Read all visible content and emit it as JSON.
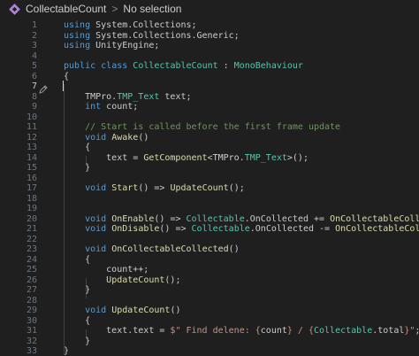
{
  "breadcrumb": {
    "file": "CollectableCount",
    "separator": ">",
    "selection": "No selection",
    "icon": "csharp-class-icon"
  },
  "editor": {
    "active_line": 7,
    "lines": [
      {
        "n": "1",
        "tokens": [
          [
            "k",
            "using"
          ],
          [
            "p",
            " System.Collections;"
          ]
        ]
      },
      {
        "n": "2",
        "tokens": [
          [
            "k",
            "using"
          ],
          [
            "p",
            " System.Collections.Generic;"
          ]
        ]
      },
      {
        "n": "3",
        "tokens": [
          [
            "k",
            "using"
          ],
          [
            "p",
            " UnityEngine;"
          ]
        ]
      },
      {
        "n": "4",
        "tokens": []
      },
      {
        "n": "5",
        "tokens": [
          [
            "k",
            "public"
          ],
          [
            "p",
            " "
          ],
          [
            "k",
            "class"
          ],
          [
            "p",
            " "
          ],
          [
            "t",
            "CollectableCount"
          ],
          [
            "p",
            " : "
          ],
          [
            "t",
            "MonoBehaviour"
          ]
        ]
      },
      {
        "n": "6",
        "tokens": [
          [
            "p",
            "{"
          ]
        ]
      },
      {
        "n": "7",
        "tokens": []
      },
      {
        "n": "8",
        "tokens": [
          [
            "p",
            "    TMPro."
          ],
          [
            "t",
            "TMP_Text"
          ],
          [
            "p",
            " text;"
          ]
        ]
      },
      {
        "n": "9",
        "tokens": [
          [
            "p",
            "    "
          ],
          [
            "k",
            "int"
          ],
          [
            "p",
            " count;"
          ]
        ]
      },
      {
        "n": "10",
        "tokens": []
      },
      {
        "n": "11",
        "tokens": [
          [
            "p",
            "    "
          ],
          [
            "c",
            "// Start is called before the first frame update"
          ]
        ]
      },
      {
        "n": "12",
        "tokens": [
          [
            "p",
            "    "
          ],
          [
            "k",
            "void"
          ],
          [
            "p",
            " "
          ],
          [
            "f",
            "Awake"
          ],
          [
            "p",
            "()"
          ]
        ]
      },
      {
        "n": "13",
        "tokens": [
          [
            "p",
            "    {"
          ]
        ]
      },
      {
        "n": "14",
        "tokens": [
          [
            "p",
            "        text = "
          ],
          [
            "f",
            "GetComponent"
          ],
          [
            "p",
            "<TMPro."
          ],
          [
            "t",
            "TMP_Text"
          ],
          [
            "p",
            ">();"
          ]
        ]
      },
      {
        "n": "15",
        "tokens": [
          [
            "p",
            "    }"
          ]
        ]
      },
      {
        "n": "16",
        "tokens": []
      },
      {
        "n": "17",
        "tokens": [
          [
            "p",
            "    "
          ],
          [
            "k",
            "void"
          ],
          [
            "p",
            " "
          ],
          [
            "f",
            "Start"
          ],
          [
            "p",
            "() => "
          ],
          [
            "f",
            "UpdateCount"
          ],
          [
            "p",
            "();"
          ]
        ]
      },
      {
        "n": "18",
        "tokens": []
      },
      {
        "n": "19",
        "tokens": []
      },
      {
        "n": "20",
        "tokens": [
          [
            "p",
            "    "
          ],
          [
            "k",
            "void"
          ],
          [
            "p",
            " "
          ],
          [
            "f",
            "OnEnable"
          ],
          [
            "p",
            "() => "
          ],
          [
            "t",
            "Collectable"
          ],
          [
            "p",
            ".OnCollected += "
          ],
          [
            "f",
            "OnCollectableCollecte"
          ]
        ]
      },
      {
        "n": "21",
        "tokens": [
          [
            "p",
            "    "
          ],
          [
            "k",
            "void"
          ],
          [
            "p",
            " "
          ],
          [
            "f",
            "OnDisable"
          ],
          [
            "p",
            "() => "
          ],
          [
            "t",
            "Collectable"
          ],
          [
            "p",
            ".OnCollected -= "
          ],
          [
            "f",
            "OnCollectableCollec"
          ]
        ]
      },
      {
        "n": "22",
        "tokens": []
      },
      {
        "n": "23",
        "tokens": [
          [
            "p",
            "    "
          ],
          [
            "k",
            "void"
          ],
          [
            "p",
            " "
          ],
          [
            "f",
            "OnCollectableCollected"
          ],
          [
            "p",
            "()"
          ]
        ]
      },
      {
        "n": "24",
        "tokens": [
          [
            "p",
            "    {"
          ]
        ]
      },
      {
        "n": "25",
        "tokens": [
          [
            "p",
            "        count++;"
          ]
        ]
      },
      {
        "n": "26",
        "tokens": [
          [
            "p",
            "        "
          ],
          [
            "f",
            "UpdateCount"
          ],
          [
            "p",
            "();"
          ]
        ]
      },
      {
        "n": "27",
        "tokens": [
          [
            "p",
            "    }"
          ]
        ]
      },
      {
        "n": "28",
        "tokens": []
      },
      {
        "n": "29",
        "tokens": [
          [
            "p",
            "    "
          ],
          [
            "k",
            "void"
          ],
          [
            "p",
            " "
          ],
          [
            "f",
            "UpdateCount"
          ],
          [
            "p",
            "()"
          ]
        ]
      },
      {
        "n": "30",
        "tokens": [
          [
            "p",
            "    {"
          ]
        ]
      },
      {
        "n": "31",
        "tokens": [
          [
            "p",
            "        text.text = "
          ],
          [
            "s",
            "$\" Find delene: {"
          ],
          [
            "p",
            "count"
          ],
          [
            "s",
            "} / {"
          ],
          [
            "t",
            "Collectable"
          ],
          [
            "p",
            ".total"
          ],
          [
            "s",
            "}\""
          ],
          [
            "p",
            ";"
          ]
        ]
      },
      {
        "n": "32",
        "tokens": [
          [
            "p",
            "    }"
          ]
        ]
      },
      {
        "n": "33",
        "tokens": [
          [
            "p",
            "}"
          ]
        ]
      }
    ]
  }
}
